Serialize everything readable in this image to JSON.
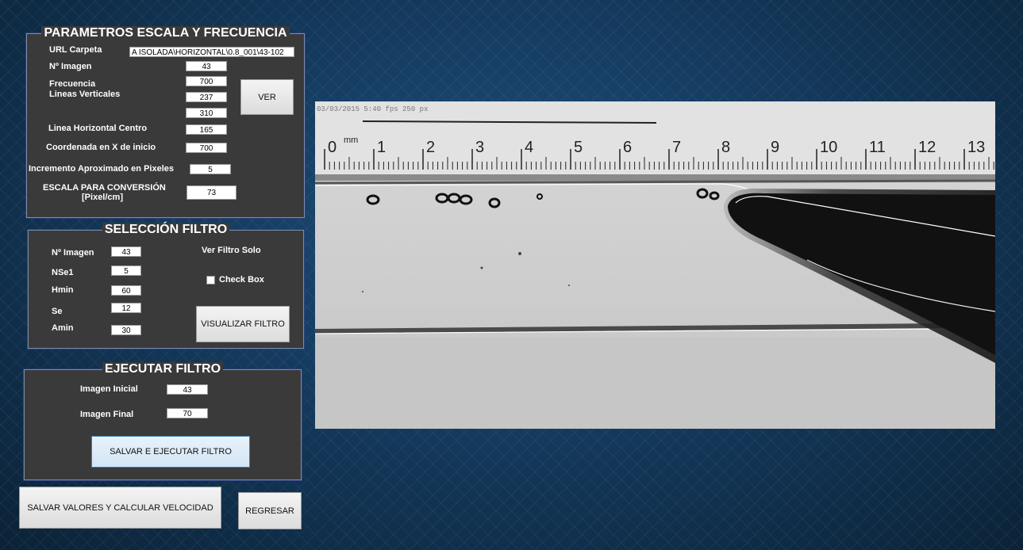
{
  "params": {
    "title": "PARAMETROS ESCALA Y FRECUENCIA",
    "url_label": "URL Carpeta",
    "url_value": "A ISOLADA\\HORIZONTAL\\0.8_001\\43-102",
    "nimagen_label": "Nº Imagen",
    "nimagen_value": "43",
    "frecuencia_label": "Frecuencia",
    "frecuencia_value": "700",
    "lineas_label": "Lineas Verticales",
    "lineas_value1": "237",
    "lineas_value2": "310",
    "ver_label": "VER",
    "lh_label": "Linea Horizontal Centro",
    "lh_value": "165",
    "cx_label": "Coordenada en X de inicio",
    "cx_value": "700",
    "inc_label": "Incremento Aproximado en Pixeles",
    "inc_value": "5",
    "escala_label_1": "ESCALA PARA CONVERSIÓN",
    "escala_label_2": "[Pixel/cm]",
    "escala_value": "73"
  },
  "filtro": {
    "title": "SELECCIÓN FILTRO",
    "nimagen_label": "Nº Imagen",
    "nimagen_value": "43",
    "nse1_label": "NSe1",
    "nse1_value": "5",
    "hmin_label": "Hmin",
    "hmin_value": "60",
    "se_label": "Se",
    "se_value": "12",
    "amin_label": "Amin",
    "amin_value": "30",
    "ver_solo_label": "Ver Filtro Solo",
    "checkbox_label": "Check Box",
    "checkbox_checked": false,
    "visualizar_label": "VISUALIZAR  FILTRO"
  },
  "ejecutar": {
    "title": "EJECUTAR FILTRO",
    "inicial_label": "Imagen Inicial",
    "inicial_value": "43",
    "final_label": "Imagen Final",
    "final_value": "70",
    "salvar_label": "SALVAR E EJECUTAR  FILTRO"
  },
  "bottom": {
    "salvar_calc_label": "SALVAR VALORES  Y CALCULAR VELOCIDAD",
    "regresar_label": "REGRESAR"
  },
  "image": {
    "header_text": "03/03/2015 5:40 fps 250 px",
    "ruler_numbers": [
      "0",
      "1",
      "2",
      "3",
      "4",
      "5",
      "6",
      "7",
      "8",
      "9",
      "10",
      "11",
      "12",
      "13"
    ],
    "ruler_unit": "mm"
  }
}
